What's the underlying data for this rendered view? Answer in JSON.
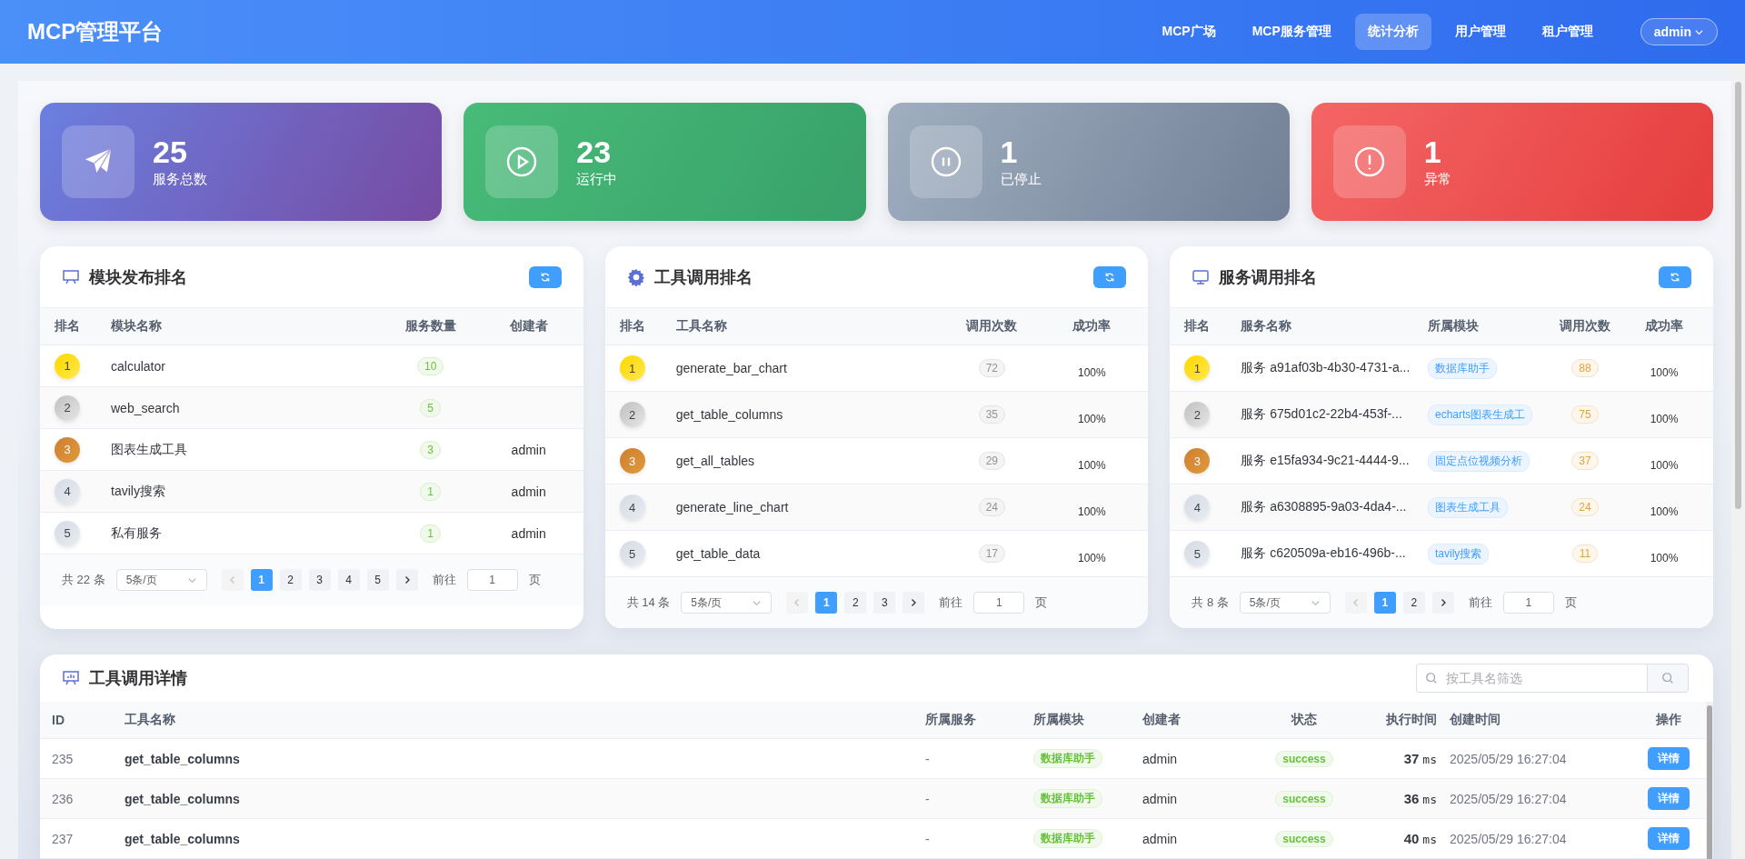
{
  "header": {
    "title": "MCP管理平台",
    "nav": [
      {
        "label": "MCP广场",
        "selected": false
      },
      {
        "label": "MCP服务管理",
        "selected": false
      },
      {
        "label": "统计分析",
        "selected": true
      },
      {
        "label": "用户管理",
        "selected": false
      },
      {
        "label": "租户管理",
        "selected": false
      }
    ],
    "user_menu": "admin"
  },
  "stats": [
    {
      "kind": "total",
      "value": "25",
      "label": "服务总数"
    },
    {
      "kind": "running",
      "value": "23",
      "label": "运行中"
    },
    {
      "kind": "stopped",
      "value": "1",
      "label": "已停止"
    },
    {
      "kind": "error",
      "value": "1",
      "label": "异常"
    }
  ],
  "rankings": [
    {
      "kind": "module",
      "title": "模块发布排名",
      "columns": [
        "排名",
        "模块名称",
        "服务数量",
        "创建者"
      ],
      "rows": [
        {
          "rank": "1",
          "name": "calculator",
          "count": "10"
        },
        {
          "rank": "2",
          "name": "web_search",
          "count": "5"
        },
        {
          "rank": "3",
          "name": "图表生成工具",
          "count": "3",
          "creator": "admin"
        },
        {
          "rank": "4",
          "name": "tavily搜索",
          "count": "1",
          "creator": "admin"
        },
        {
          "rank": "5",
          "name": "私有服务",
          "count": "1",
          "creator": "admin"
        }
      ],
      "pager": {
        "total": "共 22 条",
        "page_size": "5条/页",
        "prev_disabled": true,
        "pages": [
          {
            "label": "1",
            "selected": true
          },
          {
            "label": "2",
            "selected": false
          },
          {
            "label": "3",
            "selected": false
          },
          {
            "label": "4",
            "selected": false
          },
          {
            "label": "5",
            "selected": false
          }
        ],
        "goto_label": "前往",
        "goto_value": "1",
        "page_unit": "页"
      }
    },
    {
      "kind": "tool",
      "title": "工具调用排名",
      "columns": [
        "排名",
        "工具名称",
        "调用次数",
        "成功率"
      ],
      "rows": [
        {
          "rank": "1",
          "name": "generate_bar_chart",
          "count": "72",
          "rate": "100%"
        },
        {
          "rank": "2",
          "name": "get_table_columns",
          "count": "35",
          "rate": "100%"
        },
        {
          "rank": "3",
          "name": "get_all_tables",
          "count": "29",
          "rate": "100%"
        },
        {
          "rank": "4",
          "name": "generate_line_chart",
          "count": "24",
          "rate": "100%"
        },
        {
          "rank": "5",
          "name": "get_table_data",
          "count": "17",
          "rate": "100%"
        }
      ],
      "pager": {
        "total": "共 14 条",
        "page_size": "5条/页",
        "prev_disabled": true,
        "pages": [
          {
            "label": "1",
            "selected": true
          },
          {
            "label": "2",
            "selected": false
          },
          {
            "label": "3",
            "selected": false
          }
        ],
        "goto_label": "前往",
        "goto_value": "1",
        "page_unit": "页"
      }
    },
    {
      "kind": "service",
      "title": "服务调用排名",
      "columns": [
        "排名",
        "服务名称",
        "所属模块",
        "调用次数",
        "成功率"
      ],
      "rows": [
        {
          "rank": "1",
          "name": "服务 a91af03b-4b30-4731-a...",
          "module": "数据库助手",
          "count": "88",
          "rate": "100%"
        },
        {
          "rank": "2",
          "name": "服务 675d01c2-22b4-453f-...",
          "module": "echarts图表生成工",
          "count": "75",
          "rate": "100%"
        },
        {
          "rank": "3",
          "name": "服务 e15fa934-9c21-4444-9...",
          "module": "固定点位视频分析",
          "count": "37",
          "rate": "100%"
        },
        {
          "rank": "4",
          "name": "服务 a6308895-9a03-4da4-...",
          "module": "图表生成工具",
          "count": "24",
          "rate": "100%"
        },
        {
          "rank": "5",
          "name": "服务 c620509a-eb16-496b-...",
          "module": "tavily搜索",
          "count": "11",
          "rate": "100%"
        }
      ],
      "pager": {
        "total": "共 8 条",
        "page_size": "5条/页",
        "prev_disabled": true,
        "pages": [
          {
            "label": "1",
            "selected": true
          },
          {
            "label": "2",
            "selected": false
          }
        ],
        "goto_label": "前往",
        "goto_value": "1",
        "page_unit": "页"
      }
    }
  ],
  "details": {
    "title": "工具调用详情",
    "search_placeholder": "按工具名筛选",
    "columns": [
      "ID",
      "工具名称",
      "所属服务",
      "所属模块",
      "创建者",
      "状态",
      "执行时间",
      "创建时间",
      "操作"
    ],
    "rows": [
      {
        "id": "235",
        "tool": "get_table_columns",
        "service": "-",
        "module": "数据库助手",
        "creator": "admin",
        "status": "success",
        "duration": "37",
        "unit": "ms",
        "created": "2025/05/29 16:27:04",
        "action": "详情"
      },
      {
        "id": "236",
        "tool": "get_table_columns",
        "service": "-",
        "module": "数据库助手",
        "creator": "admin",
        "status": "success",
        "duration": "36",
        "unit": "ms",
        "created": "2025/05/29 16:27:04",
        "action": "详情"
      },
      {
        "id": "237",
        "tool": "get_table_columns",
        "service": "-",
        "module": "数据库助手",
        "creator": "admin",
        "status": "success",
        "duration": "40",
        "unit": "ms",
        "created": "2025/05/29 16:27:04",
        "action": "详情"
      }
    ]
  }
}
